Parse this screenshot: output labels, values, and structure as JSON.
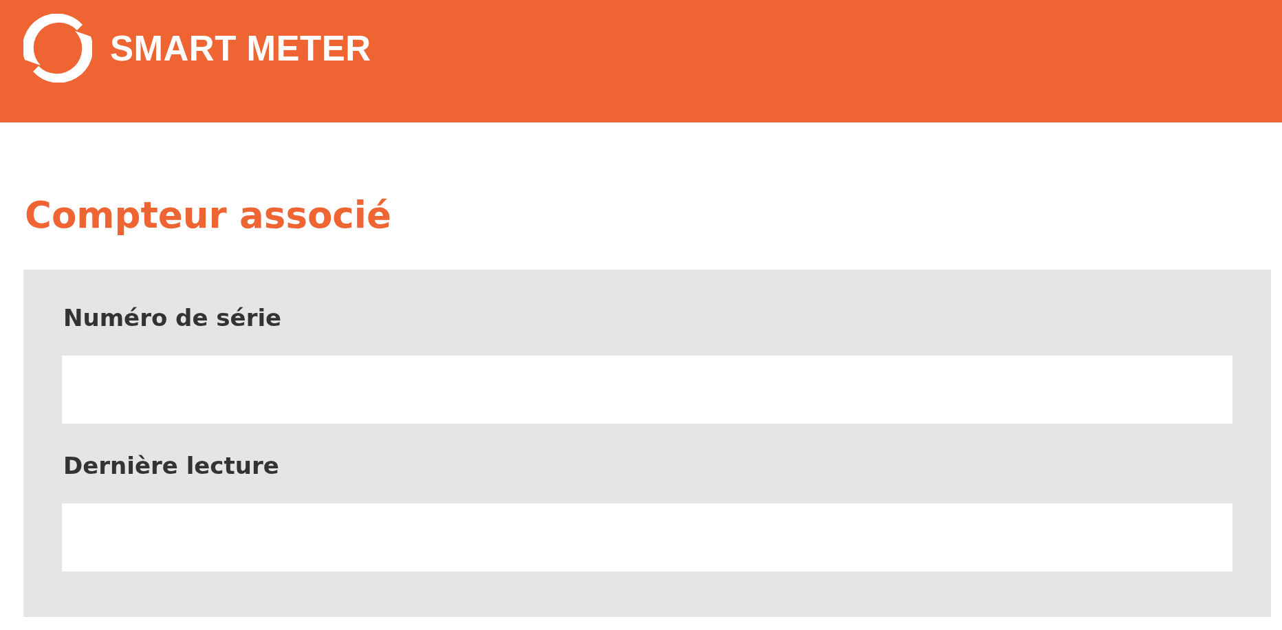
{
  "header": {
    "brand": "SMART METER"
  },
  "section": {
    "title": "Compteur associé"
  },
  "fields": [
    {
      "label": "Numéro de série"
    },
    {
      "label": "Dernière lecture"
    }
  ]
}
